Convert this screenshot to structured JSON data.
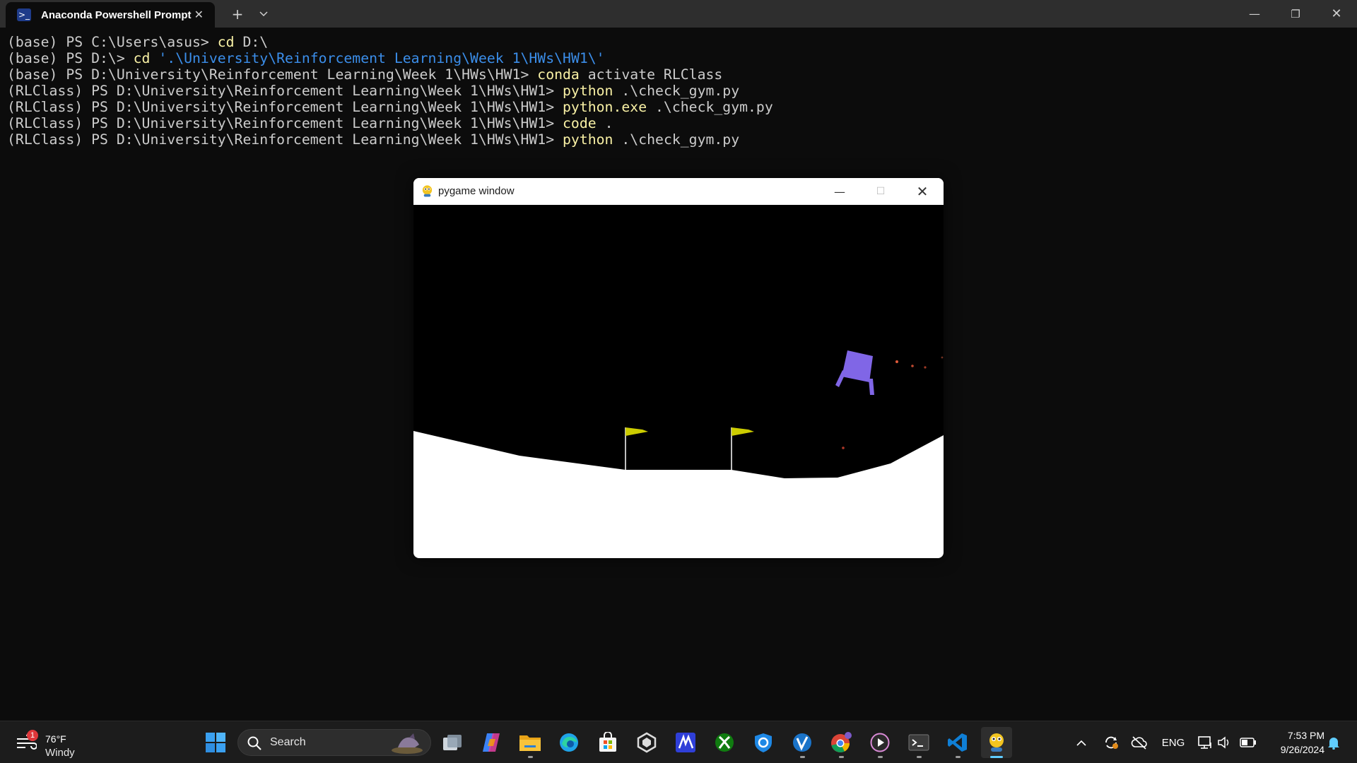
{
  "terminal_window": {
    "tab_title": "Anaconda Powershell Prompt",
    "tab_icon": "powershell-icon",
    "newtab_label": "+",
    "dropdown_label": "⌄",
    "minimize_label": "—",
    "maximize_label": "❐",
    "close_label": "✕"
  },
  "terminal": {
    "lines": [
      {
        "prompt": "(base) PS C:\\Users\\asus> ",
        "cmd": "cd",
        "rest": " D:\\",
        "string": ""
      },
      {
        "prompt": "(base) PS D:\\> ",
        "cmd": "cd",
        "rest": " ",
        "string": "'.\\University\\Reinforcement Learning\\Week 1\\HWs\\HW1\\'"
      },
      {
        "prompt": "(base) PS D:\\University\\Reinforcement Learning\\Week 1\\HWs\\HW1> ",
        "cmd": "conda",
        "rest": " activate RLClass",
        "string": ""
      },
      {
        "prompt": "(RLClass) PS D:\\University\\Reinforcement Learning\\Week 1\\HWs\\HW1> ",
        "cmd": "python",
        "rest": " .\\check_gym.py",
        "string": ""
      },
      {
        "prompt": "(RLClass) PS D:\\University\\Reinforcement Learning\\Week 1\\HWs\\HW1> ",
        "cmd": "python.exe",
        "rest": " .\\check_gym.py",
        "string": ""
      },
      {
        "prompt": "(RLClass) PS D:\\University\\Reinforcement Learning\\Week 1\\HWs\\HW1> ",
        "cmd": "code",
        "rest": " .",
        "string": ""
      },
      {
        "prompt": "(RLClass) PS D:\\University\\Reinforcement Learning\\Week 1\\HWs\\HW1> ",
        "cmd": "python",
        "rest": " .\\check_gym.py",
        "string": ""
      }
    ],
    "colors": {
      "text": "#cccccc",
      "command": "#f9f1a5",
      "string": "#3b8eea",
      "background": "#0c0c0c"
    }
  },
  "pygame_window": {
    "title": "pygame window",
    "icon": "pygame-snake-icon",
    "minimize_label": "—",
    "maximize_label": "☐",
    "close_label": "✕",
    "scene": {
      "name": "lunar-lander",
      "sky_color": "#000000",
      "terrain_color": "#ffffff",
      "lander_color": "#8066e6",
      "flag_color": "#cccc00",
      "flag_pole_color": "#ffffff",
      "particle_color": "#e05a3a"
    }
  },
  "taskbar": {
    "weather": {
      "temp": "76°F",
      "condition": "Windy",
      "badge": "1",
      "icon": "wind-icon"
    },
    "search": {
      "placeholder": "Search"
    },
    "apps": [
      {
        "name": "start-icon"
      },
      {
        "name": "task-view-icon"
      },
      {
        "name": "copilot-icon"
      },
      {
        "name": "file-explorer-icon"
      },
      {
        "name": "edge-icon"
      },
      {
        "name": "microsoft-store-icon"
      },
      {
        "name": "unity-icon"
      },
      {
        "name": "app-m-icon"
      },
      {
        "name": "xbox-icon"
      },
      {
        "name": "defender-icon"
      },
      {
        "name": "vpn-v-icon"
      },
      {
        "name": "chrome-icon"
      },
      {
        "name": "media-player-icon"
      },
      {
        "name": "terminal-icon"
      },
      {
        "name": "vscode-icon"
      },
      {
        "name": "pygame-icon"
      }
    ],
    "tray": {
      "language": "ENG",
      "time": "7:53 PM",
      "date": "9/26/2024"
    }
  }
}
